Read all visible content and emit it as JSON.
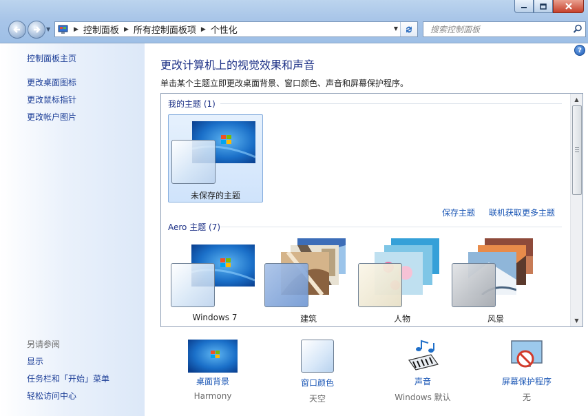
{
  "window": {
    "controls": [
      "minimize",
      "maximize",
      "close"
    ]
  },
  "address_bar": {
    "breadcrumbs": [
      "控制面板",
      "所有控制面板项",
      "个性化"
    ]
  },
  "search": {
    "placeholder": "搜索控制面板"
  },
  "sidebar": {
    "top_links": [
      {
        "label": "控制面板主页"
      },
      {
        "label": "更改桌面图标"
      },
      {
        "label": "更改鼠标指针"
      },
      {
        "label": "更改帐户图片"
      }
    ],
    "see_also_title": "另请参阅",
    "see_also_links": [
      {
        "label": "显示"
      },
      {
        "label": "任务栏和「开始」菜单"
      },
      {
        "label": "轻松访问中心"
      }
    ]
  },
  "main": {
    "title": "更改计算机上的视觉效果和声音",
    "description": "单击某个主题立即更改桌面背景、窗口颜色、声音和屏幕保护程序。",
    "my_themes": {
      "title": "我的主题 (1)",
      "items": [
        {
          "name": "未保存的主题",
          "selected": true
        }
      ]
    },
    "save_theme": "保存主题",
    "get_more_themes": "联机获取更多主题",
    "aero_themes": {
      "title": "Aero 主题 (7)",
      "items": [
        {
          "name": "Windows 7"
        },
        {
          "name": "建筑"
        },
        {
          "name": "人物"
        },
        {
          "name": "风景"
        }
      ]
    },
    "bottom": [
      {
        "label": "桌面背景",
        "value": "Harmony"
      },
      {
        "label": "窗口颜色",
        "value": "天空"
      },
      {
        "label": "声音",
        "value": "Windows 默认"
      },
      {
        "label": "屏幕保护程序",
        "value": "无"
      }
    ]
  },
  "colors": {
    "link": "#1a56b5",
    "heading": "#1e3287",
    "selection": "#cfe3fb"
  }
}
